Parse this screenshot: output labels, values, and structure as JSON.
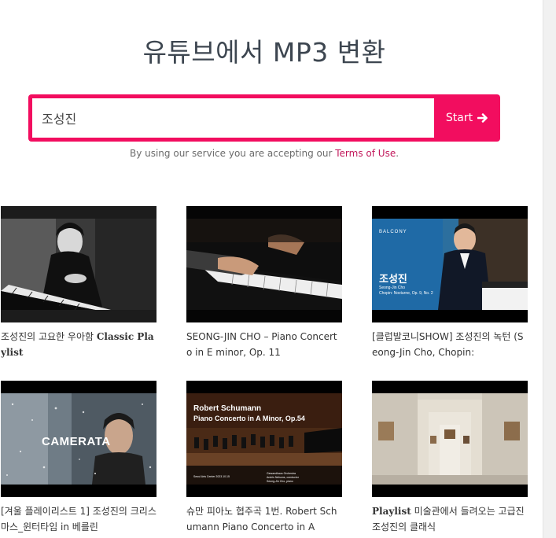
{
  "header": {
    "title": "유튜브에서 MP3 변환"
  },
  "search": {
    "value": "조성진",
    "button_label": "Start"
  },
  "terms": {
    "prefix": "By using our service you are accepting our ",
    "link": "Terms of Use",
    "suffix": "."
  },
  "results": [
    {
      "title_plain": "조성진의 고요한 우아함 ",
      "title_bold": "Classic Playlist",
      "title_rest": "",
      "thumb_text": ""
    },
    {
      "title_plain": "SEONG-JIN CHO – Piano Concerto in E minor, Op. 11",
      "title_bold": "",
      "title_rest": "",
      "thumb_text": ""
    },
    {
      "title_plain": "[클럽발코니SHOW] 조성진의 녹턴 (Seong-Jin Cho, Chopin:",
      "title_bold": "",
      "title_rest": "",
      "thumb_logo": "BALCONY",
      "thumb_name": "조성진",
      "thumb_sub": "Seong-Jin Cho",
      "thumb_sub2": "Chopin: Nocturne, Op. 9, No. 2"
    },
    {
      "title_plain": "[겨울 플레이리스트 1] 조성진의 크리스마스_윈터타임 in 베를린",
      "title_bold": "",
      "title_rest": "",
      "thumb_text": "CAMERATA"
    },
    {
      "title_plain": "슈만 피아노 협주곡 1번. Robert Schumann Piano Concerto in A",
      "title_bold": "",
      "title_rest": "",
      "thumb_line1": "Robert Schumann",
      "thumb_line2": "Piano Concerto in A Minor, Op.54",
      "thumb_foot_left": "Seoul Arts Center 2023.10.15",
      "thumb_foot_right1": "Gewandhaus Orchestra",
      "thumb_foot_right2": "Andris Nelsons, conductor",
      "thumb_foot_right3": "Seong-Jin Cho, piano"
    },
    {
      "title_plain": "",
      "title_bold": "Playlist",
      "title_rest": " 미술관에서 들려오는 고급진 조성진의 클래식",
      "thumb_text": ""
    }
  ],
  "colors": {
    "accent": "#f20d5f",
    "link": "#c2185b"
  }
}
